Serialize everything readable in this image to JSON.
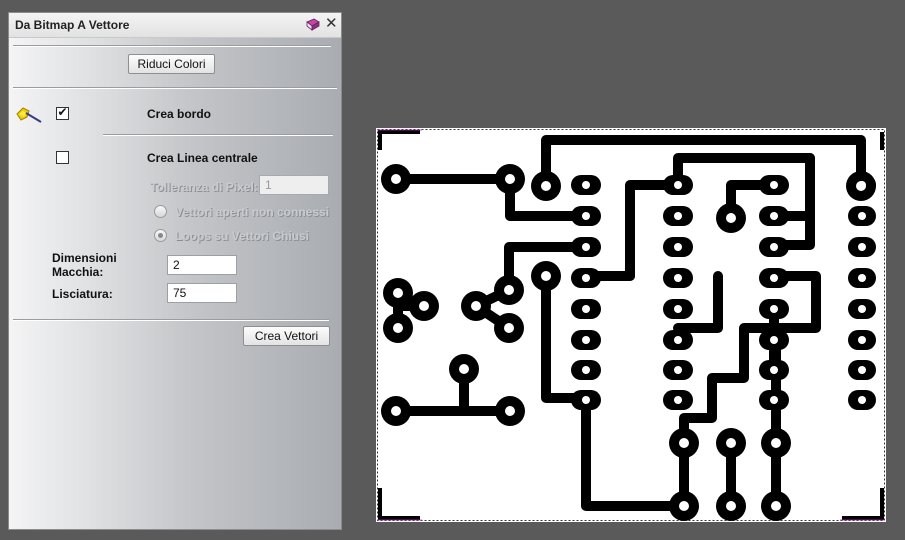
{
  "panel": {
    "title": "Da Bitmap A Vettore",
    "reduce_colors_button": "Riduci Colori",
    "create_border": {
      "label": "Crea bordo",
      "checked": true
    },
    "create_centerline": {
      "label": "Crea Linea centrale",
      "checked": false
    },
    "pixel_tolerance": {
      "label": "Tolleranza di Pixel:",
      "value": "1"
    },
    "open_vectors_option": {
      "label": "Vettori aperti non connessi",
      "selected": false
    },
    "closed_loops_option": {
      "label": "Loops su Vettori Chiusi",
      "selected": true
    },
    "spot_size": {
      "label_line1": "Dimensioni",
      "label_line2": "Macchia:",
      "value": "2"
    },
    "smoothing": {
      "label": "Lisciatura:",
      "value": "75"
    },
    "create_vectors_button": "Crea Vettori"
  },
  "icons": [
    "book-icon",
    "close-icon",
    "magic-wand-icon"
  ],
  "colors": {
    "trace": "#000000",
    "outline": "#c020c0",
    "background": "#5a5a5a"
  }
}
